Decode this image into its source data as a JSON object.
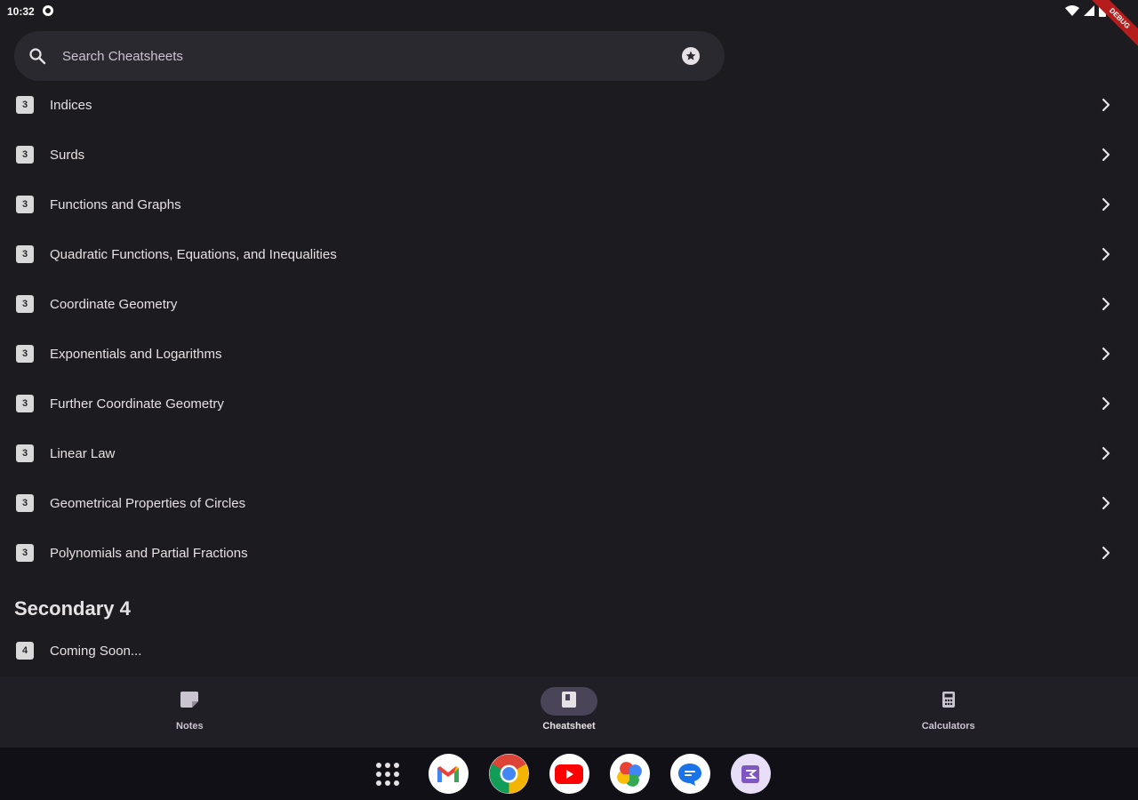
{
  "status_bar": {
    "time": "10:32"
  },
  "debug_banner": {
    "label": "DEBUG"
  },
  "search": {
    "placeholder": "Search Cheatsheets",
    "value": ""
  },
  "topics": [
    {
      "badge": "3",
      "label": "Indices"
    },
    {
      "badge": "3",
      "label": "Surds"
    },
    {
      "badge": "3",
      "label": "Functions and Graphs"
    },
    {
      "badge": "3",
      "label": "Quadratic Functions, Equations, and Inequalities"
    },
    {
      "badge": "3",
      "label": "Coordinate Geometry"
    },
    {
      "badge": "3",
      "label": "Exponentials and Logarithms"
    },
    {
      "badge": "3",
      "label": "Further Coordinate Geometry"
    },
    {
      "badge": "3",
      "label": "Linear Law"
    },
    {
      "badge": "3",
      "label": "Geometrical Properties of Circles"
    },
    {
      "badge": "3",
      "label": "Polynomials and Partial Fractions"
    }
  ],
  "section_secondary4": {
    "title": "Secondary 4",
    "items": [
      {
        "badge": "4",
        "label": "Coming Soon..."
      }
    ]
  },
  "bottom_nav": {
    "items": [
      {
        "label": "Notes",
        "icon": "notes-icon",
        "active": false
      },
      {
        "label": "Cheatsheet",
        "icon": "cheatsheet-icon",
        "active": true
      },
      {
        "label": "Calculators",
        "icon": "calculator-icon",
        "active": false
      }
    ]
  },
  "taskbar": {
    "apps": [
      "all-apps-icon",
      "gmail-icon",
      "chrome-icon",
      "youtube-icon",
      "photos-icon",
      "messages-icon",
      "app-icon"
    ]
  },
  "colors": {
    "background": "#1c1b1f",
    "surface": "#2b2930",
    "nav_bg": "#211f26",
    "active_pill": "#4a4458",
    "text": "#e6e1e5"
  }
}
